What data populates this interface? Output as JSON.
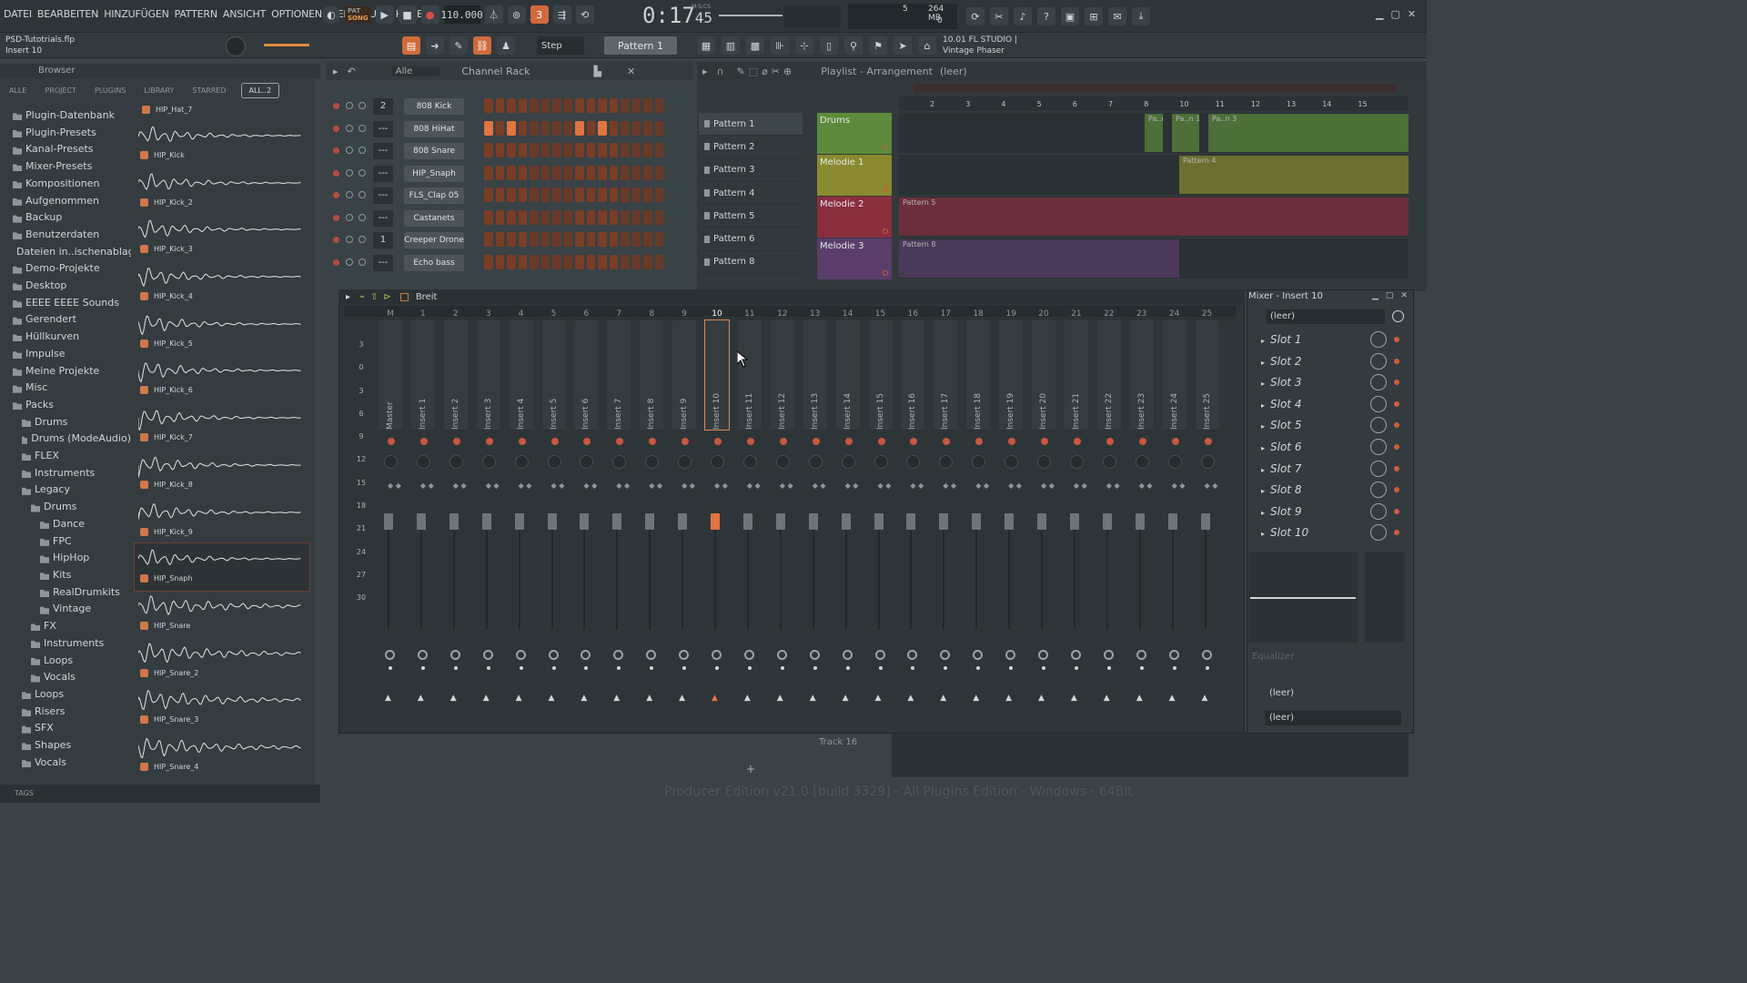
{
  "menu": [
    "DATEI",
    "BEARBEITEN",
    "HINZUFÜGEN",
    "PATTERN",
    "ANSICHT",
    "OPTIONEN",
    "WERKZEUGE",
    "HILFE"
  ],
  "transport": {
    "mode_top": "PAT",
    "mode_bottom": "SONG",
    "tempo": "110.000",
    "time": "0:17",
    "time_small": "45",
    "time_unit": "M:S:CS",
    "cpu_top": "5",
    "memory": "264 MB",
    "cpu_bottom": "0"
  },
  "project": {
    "file": "PSD-Tutotrials.flp",
    "target": "Insert 10"
  },
  "toolbar": {
    "snap": "Step",
    "pattern": "Pattern 1",
    "plugin_line1": "10.01  FL STUDIO |",
    "plugin_line2": "Vintage Phaser"
  },
  "browser": {
    "title": "Browser",
    "tabs": [
      "ALLE",
      "PROJECT",
      "PLUGINS",
      "LIBRARY",
      "STARRED",
      "ALL..2"
    ],
    "tree": [
      {
        "label": "Plugin-Datenbank",
        "level": 0
      },
      {
        "label": "Plugin-Presets",
        "level": 0
      },
      {
        "label": "Kanal-Presets",
        "level": 0
      },
      {
        "label": "Mixer-Presets",
        "level": 0
      },
      {
        "label": "Kompositionen",
        "level": 0
      },
      {
        "label": "Aufgenommen",
        "level": 0
      },
      {
        "label": "Backup",
        "level": 0
      },
      {
        "label": "Benutzerdaten",
        "level": 0
      },
      {
        "label": "Dateien in..ischenablage",
        "level": 0
      },
      {
        "label": "Demo-Projekte",
        "level": 0
      },
      {
        "label": "Desktop",
        "level": 0
      },
      {
        "label": "EEEE EEEE Sounds",
        "level": 0
      },
      {
        "label": "Gerendert",
        "level": 0
      },
      {
        "label": "Hüllkurven",
        "level": 0
      },
      {
        "label": "Impulse",
        "level": 0
      },
      {
        "label": "Meine Projekte",
        "level": 0
      },
      {
        "label": "Misc",
        "level": 0
      },
      {
        "label": "Packs",
        "level": 0
      },
      {
        "label": "Drums",
        "level": 1
      },
      {
        "label": "Drums (ModeAudio)",
        "level": 1
      },
      {
        "label": "FLEX",
        "level": 1
      },
      {
        "label": "Instruments",
        "level": 1
      },
      {
        "label": "Legacy",
        "level": 1
      },
      {
        "label": "Drums",
        "level": 2
      },
      {
        "label": "Dance",
        "level": 3
      },
      {
        "label": "FPC",
        "level": 3
      },
      {
        "label": "HipHop",
        "level": 3
      },
      {
        "label": "Kits",
        "level": 3
      },
      {
        "label": "RealDrumkits",
        "level": 3
      },
      {
        "label": "Vintage",
        "level": 3
      },
      {
        "label": "FX",
        "level": 2
      },
      {
        "label": "Instruments",
        "level": 2
      },
      {
        "label": "Loops",
        "level": 2
      },
      {
        "label": "Vocals",
        "level": 2
      },
      {
        "label": "Loops",
        "level": 1
      },
      {
        "label": "Risers",
        "level": 1
      },
      {
        "label": "SFX",
        "level": 1
      },
      {
        "label": "Shapes",
        "level": 1
      },
      {
        "label": "Vocals",
        "level": 1
      }
    ],
    "samples": [
      "HIP_Kick",
      "HIP_Kick_2",
      "HIP_Kick_3",
      "HIP_Kick_4",
      "HIP_Kick_5",
      "HIP_Kick_6",
      "HIP_Kick_7",
      "HIP_Kick_8",
      "HIP_Kick_9",
      "HIP_Snaph",
      "HIP_Snare",
      "HIP_Snare_2",
      "HIP_Snare_3",
      "HIP_Snare_4"
    ],
    "top_sample": "HIP_Hat_7",
    "selected_sample": "HIP_Snaph",
    "tags": "TAGS"
  },
  "rack": {
    "title": "Channel Rack",
    "filter": "Alle",
    "channels": [
      {
        "num": "2",
        "name": "808 Kick",
        "steps": [
          0,
          0,
          0,
          0,
          0,
          0,
          0,
          0,
          0,
          0,
          0,
          0,
          0,
          0,
          0,
          0
        ]
      },
      {
        "num": "---",
        "name": "808 HiHat",
        "steps": [
          1,
          0,
          1,
          0,
          1,
          0,
          1,
          0,
          1,
          0,
          1,
          0,
          1,
          0,
          1,
          0
        ]
      },
      {
        "num": "---",
        "name": "808 Snare",
        "steps": [
          0,
          0,
          0,
          0,
          1,
          0,
          0,
          0,
          0,
          0,
          0,
          0,
          1,
          0,
          0,
          0
        ]
      },
      {
        "num": "---",
        "name": "HIP_Snaph",
        "steps": [
          0,
          0,
          0,
          0,
          0,
          0,
          1,
          0,
          0,
          0,
          0,
          0,
          0,
          0,
          0,
          0
        ]
      },
      {
        "num": "---",
        "name": "FLS_Clap 05",
        "steps": [
          0,
          0,
          0,
          0,
          1,
          0,
          0,
          0,
          0,
          0,
          0,
          0,
          1,
          0,
          0,
          0
        ]
      },
      {
        "num": "---",
        "name": "Castanets",
        "steps": [
          0,
          0,
          0,
          0,
          0,
          0,
          0,
          0,
          0,
          0,
          0,
          0,
          0,
          0,
          0,
          0
        ]
      },
      {
        "num": "1",
        "name": "Creeper Drone",
        "steps": [
          0,
          0,
          0,
          0,
          0,
          0,
          0,
          0,
          0,
          0,
          0,
          0,
          0,
          0,
          0,
          0
        ]
      },
      {
        "num": "---",
        "name": "Echo bass",
        "steps": [
          0,
          0,
          0,
          0,
          0,
          0,
          0,
          0,
          0,
          0,
          0,
          0,
          0,
          0,
          0,
          0
        ]
      }
    ]
  },
  "playlist": {
    "title": "Playlist - Arrangement",
    "subtitle": "(leer)",
    "patterns": [
      "Pattern 1",
      "Pattern 2",
      "Pattern 3",
      "Pattern 4",
      "Pattern 5",
      "Pattern 6",
      "Pattern 8"
    ],
    "ruler": [
      "2",
      "3",
      "4",
      "5",
      "6",
      "7",
      "8",
      "10",
      "11",
      "12",
      "13",
      "14",
      "15"
    ],
    "tracks": [
      {
        "name": "Drums",
        "color": "#5d8a3a"
      },
      {
        "name": "Melodie 1",
        "color": "#8a8a2e"
      },
      {
        "name": "Melodie 2",
        "color": "#8a2e3e"
      },
      {
        "name": "Melodie 3",
        "color": "#5a3d6b"
      }
    ],
    "clips": {
      "drums": "Pa..n 2",
      "drums_b": "Pa..n 1",
      "drums_c": "Pa..n 3",
      "mel1": "Pattern 4",
      "mel2": "Pattern 5",
      "mel3": "Pattern 8"
    },
    "track16": "Track 16"
  },
  "mixer": {
    "layout": "Breit",
    "strips": [
      "Master",
      "Insert 1",
      "Insert 2",
      "Insert 3",
      "Insert 4",
      "Insert 5",
      "Insert 6",
      "Insert 7",
      "Insert 8",
      "Insert 9",
      "Insert 10",
      "Insert 11",
      "Insert 12",
      "Insert 13",
      "Insert 14",
      "Insert 15",
      "Insert 16",
      "Insert 17",
      "Insert 18",
      "Insert 19",
      "Insert 20",
      "Insert 21",
      "Insert 22",
      "Insert 23",
      "Insert 24",
      "Insert 25"
    ],
    "numbers": [
      "M",
      "1",
      "2",
      "3",
      "4",
      "5",
      "6",
      "7",
      "8",
      "9",
      "10",
      "11",
      "12",
      "13",
      "14",
      "15",
      "16",
      "17",
      "18",
      "19",
      "20",
      "21",
      "22",
      "23",
      "24",
      "25"
    ],
    "selected": "Insert 10",
    "db": [
      "3",
      "0",
      "3",
      "6",
      "9",
      "12",
      "15",
      "18",
      "21",
      "24",
      "27",
      "30"
    ]
  },
  "insert": {
    "title": "Mixer - Insert 10",
    "preset": "(leer)",
    "slots": [
      "Slot 1",
      "Slot 2",
      "Slot 3",
      "Slot 4",
      "Slot 5",
      "Slot 6",
      "Slot 7",
      "Slot 8",
      "Slot 9",
      "Slot 10"
    ],
    "eq": "Equalizer",
    "out1": "(leer)",
    "out2": "(leer)"
  },
  "status": "Producer Edition v21.0 [build 3329] - All Plugins Edition - Windows - 64Bit"
}
